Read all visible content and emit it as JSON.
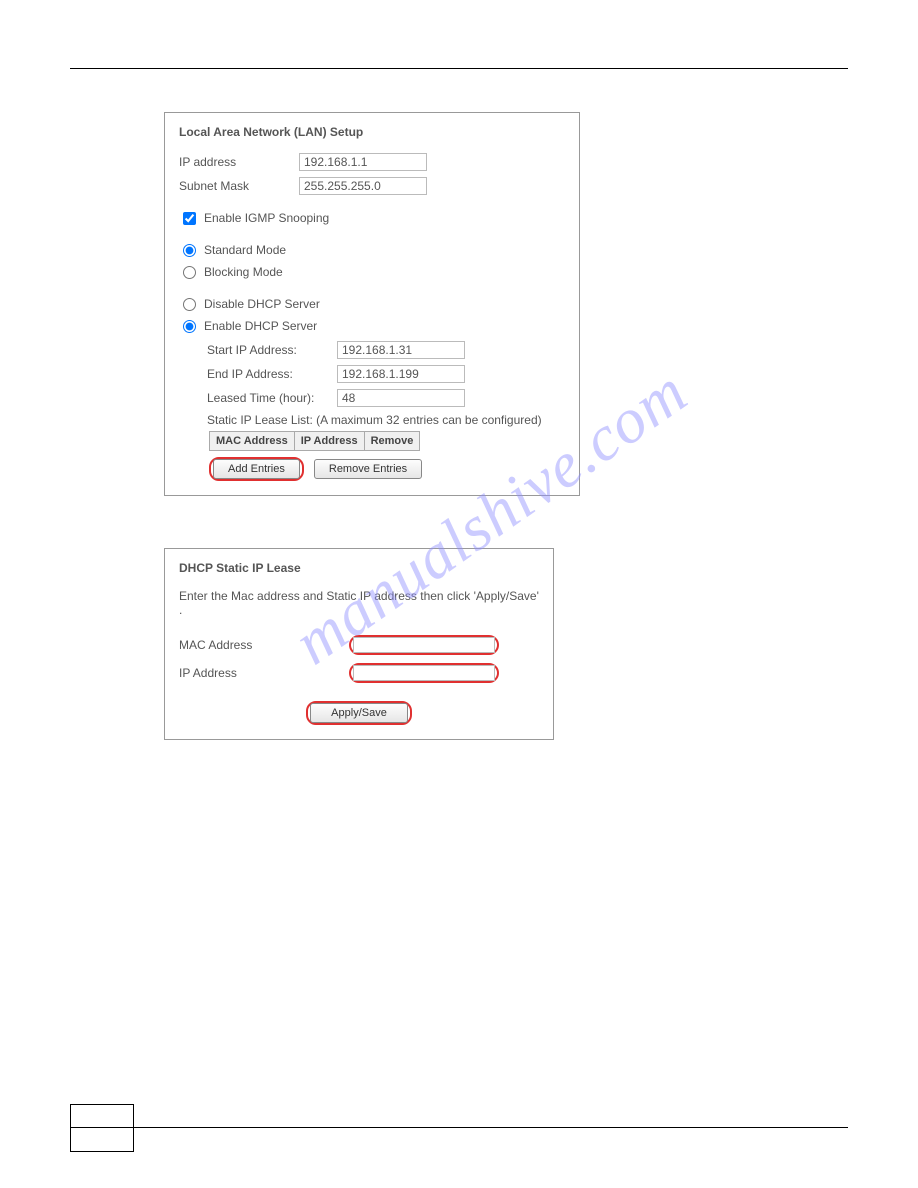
{
  "watermark": "manualshive.com",
  "panel1": {
    "title": "Local Area Network (LAN) Setup",
    "ip_address_label": "IP address",
    "ip_address_value": "192.168.1.1",
    "subnet_label": "Subnet Mask",
    "subnet_value": "255.255.255.0",
    "igmp_label": "Enable IGMP Snooping",
    "standard_mode_label": "Standard Mode",
    "blocking_mode_label": "Blocking Mode",
    "disable_dhcp_label": "Disable DHCP Server",
    "enable_dhcp_label": "Enable DHCP Server",
    "start_ip_label": "Start IP Address:",
    "start_ip_value": "192.168.1.31",
    "end_ip_label": "End IP Address:",
    "end_ip_value": "192.168.1.199",
    "leased_time_label": "Leased Time (hour):",
    "leased_time_value": "48",
    "static_list_note": "Static IP Lease List: (A maximum 32 entries can be configured)",
    "table_headers": {
      "mac": "MAC Address",
      "ip": "IP Address",
      "remove": "Remove"
    },
    "add_entries_label": "Add Entries",
    "remove_entries_label": "Remove Entries"
  },
  "panel2": {
    "title": "DHCP Static IP Lease",
    "instruction": "Enter the Mac address and Static IP address then click 'Apply/Save' .",
    "mac_label": "MAC Address",
    "ip_label": "IP Address",
    "apply_save_label": "Apply/Save"
  }
}
